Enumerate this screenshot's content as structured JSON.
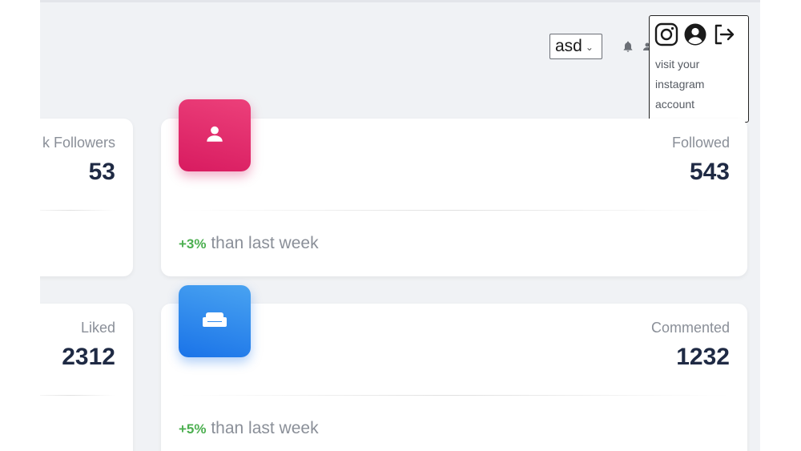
{
  "header": {
    "select_value": "asd",
    "select_chevron": "⌄"
  },
  "popup": {
    "text": "visit your instagram account",
    "icons": [
      "instagram-icon",
      "account-circle-icon",
      "logout-icon"
    ]
  },
  "cards": [
    {
      "label": "k Followers",
      "value": "53",
      "footer_pct": "",
      "footer_text": ""
    },
    {
      "label": "Followed",
      "value": "543",
      "footer_pct": "+3%",
      "footer_text": " than last week",
      "icon": "person-icon",
      "color": "#d81b60"
    },
    {
      "label": "Liked",
      "value": "2312",
      "footer_pct": "",
      "footer_text": ""
    },
    {
      "label": "Commented",
      "value": "1232",
      "footer_pct": "+5%",
      "footer_text": " than last week",
      "icon": "weekend-icon",
      "color": "#1a73e8"
    }
  ],
  "colors": {
    "background": "#f0f2f5",
    "positive": "#4caf50",
    "value_text": "#1f2a44"
  }
}
